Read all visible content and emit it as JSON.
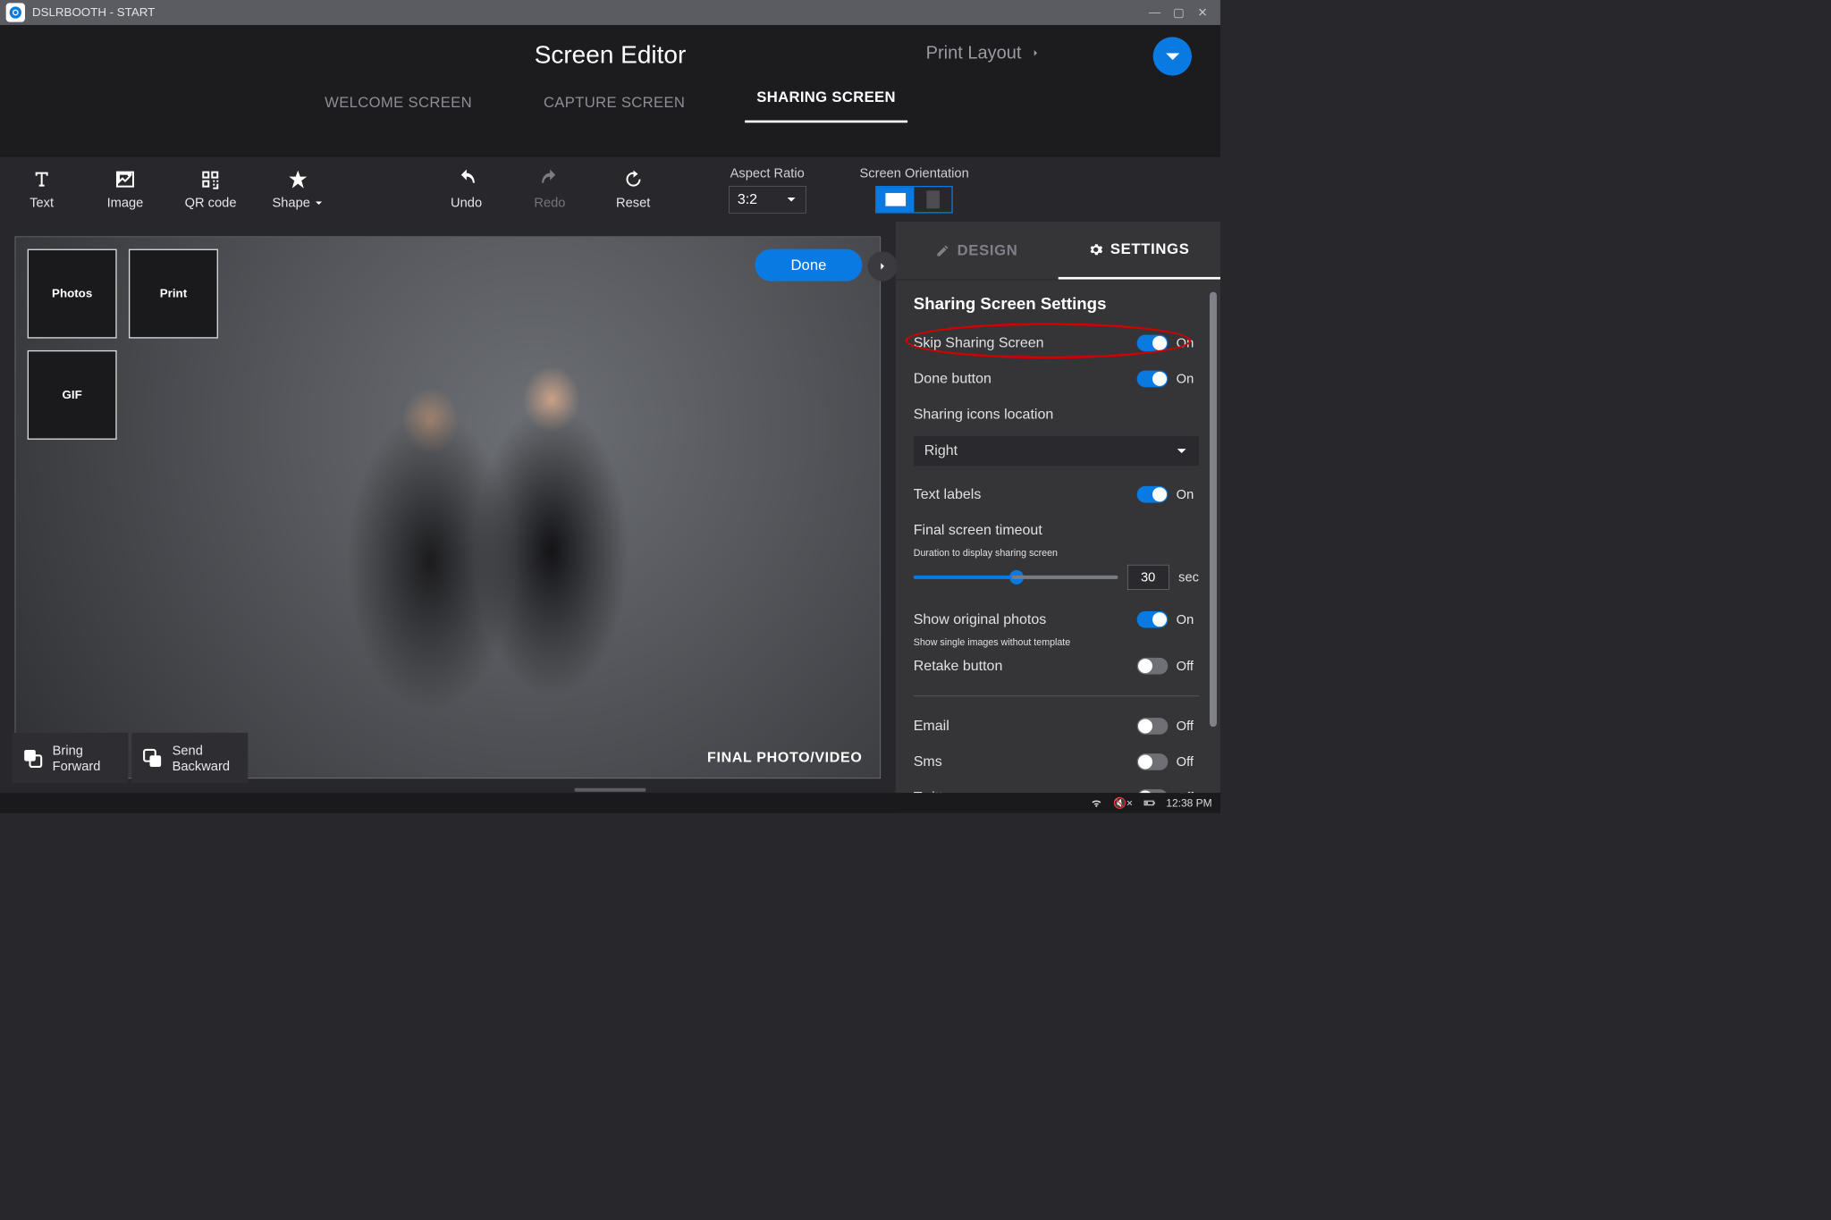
{
  "window": {
    "title": "DSLRBOOTH - START"
  },
  "header": {
    "title": "Screen Editor",
    "print_layout": "Print Layout",
    "tabs": {
      "welcome": "WELCOME SCREEN",
      "capture": "CAPTURE SCREEN",
      "sharing": "SHARING SCREEN"
    }
  },
  "toolbar": {
    "text": "Text",
    "image": "Image",
    "qr": "QR code",
    "shape": "Shape",
    "undo": "Undo",
    "redo": "Redo",
    "reset": "Reset",
    "ratio_label": "Aspect Ratio",
    "ratio_value": "3:2",
    "orient_label": "Screen Orientation"
  },
  "canvas": {
    "thumbs": {
      "photos": "Photos",
      "print": "Print",
      "gif": "GIF"
    },
    "done": "Done",
    "final": "FINAL PHOTO/VIDEO"
  },
  "sidetabs": {
    "design": "DESIGN",
    "settings": "SETTINGS"
  },
  "settings": {
    "title": "Sharing Screen Settings",
    "skip": "Skip Sharing Screen",
    "done_btn": "Done button",
    "icons_loc_label": "Sharing icons location",
    "icons_loc_value": "Right",
    "text_labels": "Text labels",
    "timeout_title": "Final screen timeout",
    "timeout_sub": "Duration to display sharing screen",
    "timeout_value": "30",
    "sec": "sec",
    "show_original": "Show original photos",
    "show_original_sub": "Show single images without template",
    "retake": "Retake button",
    "email": "Email",
    "sms": "Sms",
    "twitter": "Twitter",
    "on": "On",
    "off": "Off"
  },
  "bottom": {
    "bring": "Bring\nForward",
    "send": "Send\nBackward"
  },
  "tray": {
    "time": "12:38 PM"
  }
}
